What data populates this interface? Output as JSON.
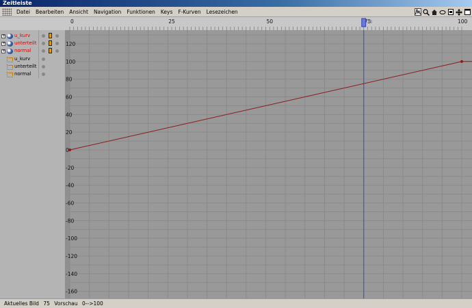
{
  "window": {
    "title": "Zeitleiste"
  },
  "menu": {
    "items": [
      "Datei",
      "Bearbeiten",
      "Ansicht",
      "Navigation",
      "Funktionen",
      "Keys",
      "F-Kurven",
      "Lesezeichen"
    ]
  },
  "toolbar": {
    "icons": [
      "fcurve-mode-icon",
      "zoom-icon",
      "home-icon",
      "ellipse-icon",
      "frame-icon",
      "move-icon",
      "window-icon"
    ]
  },
  "tracks": [
    {
      "name": "u_kurv",
      "type": "object",
      "highlight": true
    },
    {
      "name": "unterteilt",
      "type": "object",
      "highlight": true
    },
    {
      "name": "normal",
      "type": "object",
      "highlight": true
    },
    {
      "name": "u_kurv",
      "type": "curve",
      "highlight": false
    },
    {
      "name": "unterteilt",
      "type": "curve",
      "highlight": false
    },
    {
      "name": "normal",
      "type": "curve",
      "highlight": false
    }
  ],
  "ruler": {
    "ticks": [
      "0",
      "25",
      "50",
      "75",
      "100"
    ],
    "current_frame_label": "75"
  },
  "chart_data": {
    "type": "line",
    "x_range": [
      0,
      100
    ],
    "y_range": [
      -165,
      135
    ],
    "y_ticks": [
      "120",
      "100",
      "80",
      "60",
      "40",
      "20",
      "0",
      "-20",
      "-40",
      "-60",
      "-80",
      "-100",
      "-120",
      "-140",
      "-160"
    ],
    "y_tick_values": [
      120,
      100,
      80,
      60,
      40,
      20,
      0,
      -20,
      -40,
      -60,
      -80,
      -100,
      -120,
      -140,
      -160
    ],
    "current_frame": 75,
    "series": [
      {
        "points": [
          [
            0,
            0
          ],
          [
            100,
            100
          ]
        ],
        "color": "#8b1a1a"
      }
    ],
    "grid": true
  },
  "status": {
    "label_current": "Aktuelles Bild",
    "current_value": "75",
    "label_preview": "Vorschau",
    "preview_range": "0-->100"
  },
  "colors": {
    "curve": "#8b1a1a",
    "playhead": "#3050c8",
    "grid_bg": "#999999",
    "grid_line": "#8a8a8a"
  }
}
